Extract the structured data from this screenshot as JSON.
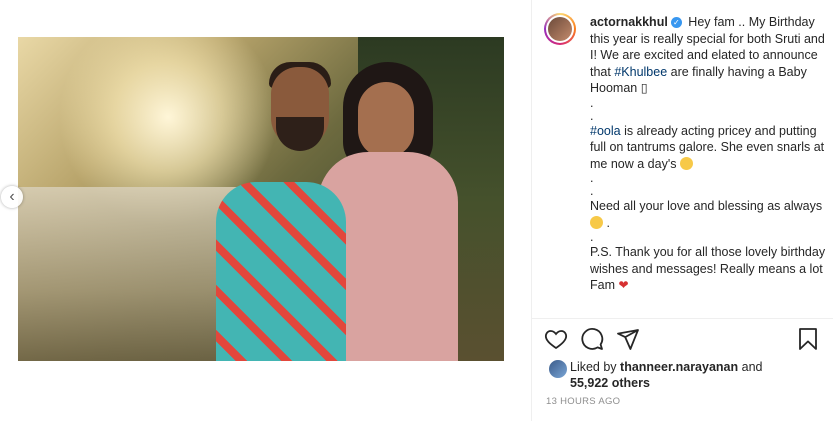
{
  "post": {
    "carousel_prev_glyph": "‹"
  },
  "author": {
    "username": "actornakkhul",
    "verified_glyph": "✓"
  },
  "caption": {
    "line1": "Hey fam .. My Birthday this year is really special for both Sruti and I! We are excited and elated to announce that ",
    "hashtag1": "#Khulbee",
    "line1_end": " are finally having a Baby Hooman ",
    "tofu": "▯",
    "dot": ".",
    "hashtag2": "#oola",
    "line2": " is already acting pricey and putting full on tantrums galore. She even snarls at me now a day's ",
    "line3": "Need all your love and blessing as always ",
    "line3_end": " .",
    "line4": "P.S. Thank you for all those lovely birthday wishes and messages! Really means a lot Fam ",
    "heart": "❤"
  },
  "likes": {
    "prefix": "Liked by ",
    "user": "thanneer.narayanan",
    "middle": " and",
    "count": "55,922 others"
  },
  "timestamp": "13 HOURS AGO",
  "icons": [
    "heart-icon",
    "comment-icon",
    "share-icon",
    "bookmark-icon"
  ]
}
